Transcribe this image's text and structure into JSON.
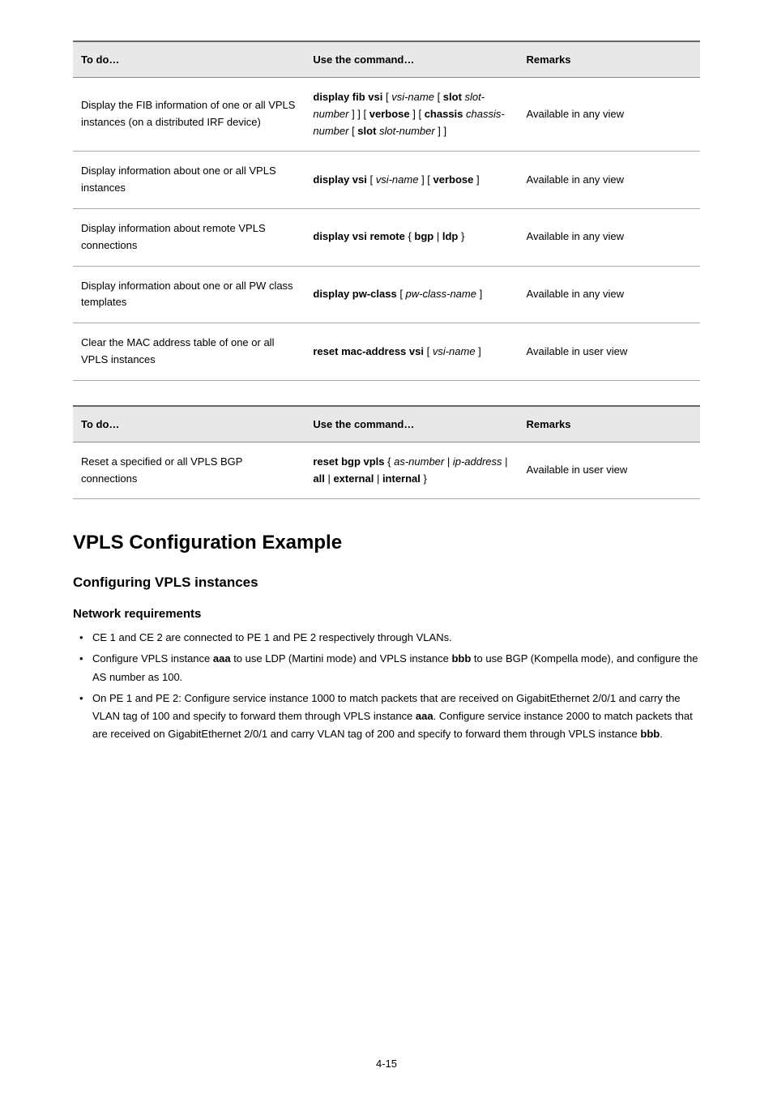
{
  "table1": {
    "headers": [
      "To do…",
      "Use the command…",
      "Remarks"
    ],
    "rows": [
      {
        "desc": "Display the FIB information of one or all VPLS instances (on a distributed IRF device)",
        "cmd_html": "<span class='bold'>display fib vsi</span> [ <span class='italic'>vsi-name</span> [ <span class='bold'>slot</span> <span class='italic'>slot-number</span> ] ] [ <span class='bold'>verbose</span> ] [ <span class='bold'>chassis</span> <span class='italic'>chassis-number</span> [ <span class='bold'>slot</span> <span class='italic'>slot-number</span> ] ]",
        "remarks": "Available in any view"
      },
      {
        "desc": "Display information about one or all VPLS instances",
        "cmd_html": "<span class='bold'>display vsi</span> [ <span class='italic'>vsi-name</span> ] [ <span class='bold'>verbose</span> ]",
        "remarks": "Available in any view"
      },
      {
        "desc": "Display information about remote VPLS connections",
        "cmd_html": "<span class='bold'>display vsi remote</span> { <span class='bold'>bgp</span> | <span class='bold'>ldp</span> }",
        "remarks": "Available in any view"
      },
      {
        "desc": "Display information about one or all PW class templates",
        "cmd_html": "<span class='bold'>display pw-class</span> [ <span class='italic'>pw-class-name</span> ]",
        "remarks": "Available in any view"
      },
      {
        "desc": "Clear the MAC address table of one or all VPLS instances",
        "cmd_html": "<span class='bold'>reset mac-address vsi</span> [ <span class='italic'>vsi-name</span> ]",
        "remarks": "Available in user view"
      }
    ]
  },
  "table2": {
    "headers": [
      "To do…",
      "Use the command…",
      "Remarks"
    ],
    "rows": [
      {
        "desc": "Reset a specified or all VPLS BGP connections",
        "cmd_html": "<span class='bold'>reset bgp vpls</span> { <span class='italic'>as-number</span> | <span class='italic'>ip-address</span> | <span class='bold'>all</span> | <span class='bold'>external</span> | <span class='bold'>internal</span> }",
        "remarks": "Available in user view"
      }
    ]
  },
  "headings": {
    "h1": "VPLS Configuration Example",
    "h2": "Configuring VPLS instances",
    "h3": "Network requirements"
  },
  "bullets": [
    {
      "html": "CE 1 and CE 2 are connected to PE 1 and PE 2 respectively through VLANs."
    },
    {
      "html": "Configure VPLS instance <span class='bold'>aaa</span> to use LDP (Martini mode) and VPLS instance <span class='bold'>bbb</span> to use BGP (Kompella mode), and configure the AS number as 100."
    },
    {
      "html": "On PE 1 and PE 2: Configure service instance 1000 to match packets that are received on GigabitEthernet 2/0/1 and carry the VLAN tag of 100 and specify to forward them through VPLS instance <span class='bold'>aaa</span>. Configure service instance 2000 to match packets that are received on GigabitEthernet 2/0/1 and carry VLAN tag of 200 and specify to forward them through VPLS instance <span class='bold'>bbb</span>."
    }
  ],
  "pagenum": "4-15"
}
